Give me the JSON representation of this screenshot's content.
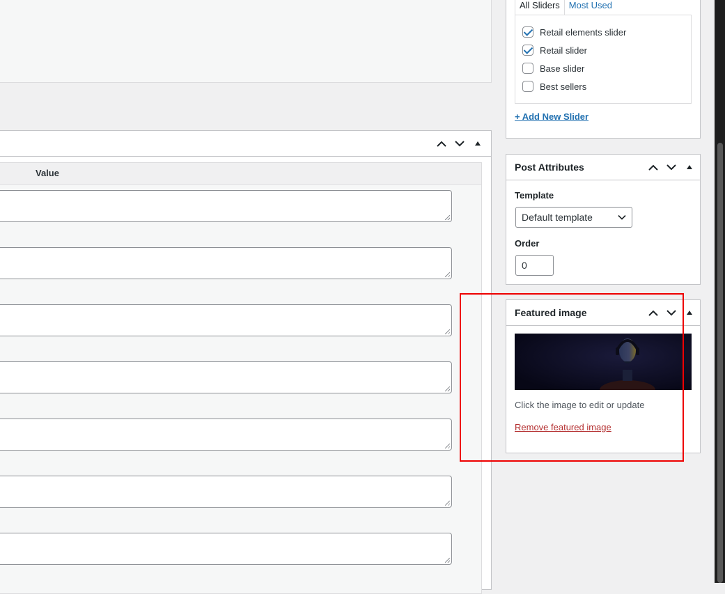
{
  "custom_fields": {
    "column_value": "Value"
  },
  "sliders": {
    "tabs": [
      "All Sliders",
      "Most Used"
    ],
    "items": [
      {
        "label": "Retail elements slider",
        "checked": true
      },
      {
        "label": "Retail slider",
        "checked": true
      },
      {
        "label": "Base slider",
        "checked": false
      },
      {
        "label": "Best sellers",
        "checked": false
      }
    ],
    "add_new": "+ Add New Slider"
  },
  "post_attributes": {
    "title": "Post Attributes",
    "template_label": "Template",
    "template_value": "Default template",
    "order_label": "Order",
    "order_value": "0"
  },
  "featured_image": {
    "title": "Featured image",
    "hint": "Click the image to edit or update",
    "remove": "Remove featured image"
  },
  "icons": {
    "move_up": "chevron-up-icon",
    "move_down": "chevron-down-icon",
    "toggle": "triangle-up-icon"
  },
  "colors": {
    "link": "#2271b1",
    "danger": "#b32d2e",
    "highlight": "#e00000"
  }
}
